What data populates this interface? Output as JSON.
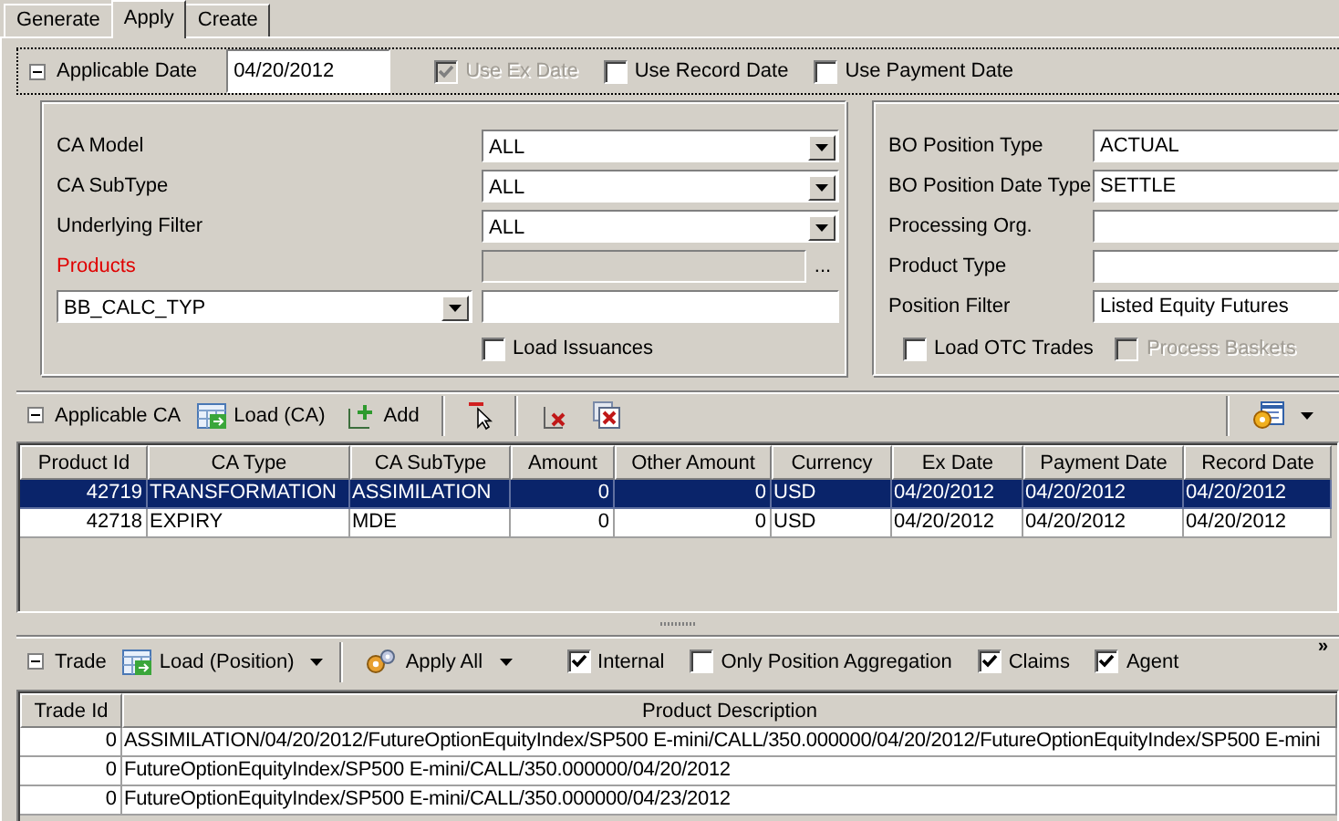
{
  "tabs": [
    {
      "label": "Generate",
      "selected": false
    },
    {
      "label": "Apply",
      "selected": true
    },
    {
      "label": "Create",
      "selected": false
    }
  ],
  "applicable_date": {
    "label": "Applicable Date",
    "expanded": true,
    "value": "04/20/2012",
    "options": [
      {
        "label": "Use Ex Date",
        "checked": true,
        "disabled": true
      },
      {
        "label": "Use Record Date",
        "checked": false,
        "disabled": false
      },
      {
        "label": "Use Payment Date",
        "checked": false,
        "disabled": false
      }
    ]
  },
  "ca_filter": {
    "rows": [
      {
        "label": "CA Model",
        "kind": "dropdown",
        "value": "ALL",
        "required": false
      },
      {
        "label": "CA SubType",
        "kind": "dropdown",
        "value": "ALL",
        "required": false
      },
      {
        "label": "Underlying Filter",
        "kind": "dropdown",
        "value": "ALL",
        "required": false
      },
      {
        "label": "Products",
        "kind": "picker",
        "button": "...",
        "required": true
      }
    ],
    "attribute": {
      "value": "BB_CALC_TYP"
    },
    "load_issuances": {
      "label": "Load Issuances",
      "checked": false
    }
  },
  "position_filter": {
    "rows": [
      {
        "label": "BO Position Type",
        "value": "ACTUAL"
      },
      {
        "label": "BO Position Date Type",
        "value": "SETTLE"
      },
      {
        "label": "Processing Org."
      },
      {
        "label": "Product Type"
      },
      {
        "label": "Position Filter",
        "value": "Listed Equity Futures"
      }
    ],
    "options": [
      {
        "label": "Load OTC Trades",
        "checked": false,
        "disabled": false
      },
      {
        "label": "Process Baskets",
        "checked": false,
        "disabled": true
      }
    ]
  },
  "applicable_ca": {
    "label": "Applicable CA",
    "expanded": true,
    "toolbar": [
      {
        "kind": "load",
        "label": "Load (CA)"
      },
      {
        "kind": "add",
        "label": "Add"
      },
      {
        "kind": "separator"
      },
      {
        "kind": "remove-pointer"
      },
      {
        "kind": "separator"
      },
      {
        "kind": "delete"
      },
      {
        "kind": "delete-all"
      }
    ],
    "table": {
      "columns": [
        {
          "label": "Product Id",
          "kind": "number"
        },
        {
          "label": "CA Type",
          "kind": "text"
        },
        {
          "label": "CA SubType",
          "kind": "text"
        },
        {
          "label": "Amount",
          "kind": "number"
        },
        {
          "label": "Other Amount",
          "kind": "number"
        },
        {
          "label": "Currency",
          "kind": "text"
        },
        {
          "label": "Ex Date",
          "kind": "text"
        },
        {
          "label": "Payment Date",
          "kind": "text"
        },
        {
          "label": "Record Date",
          "kind": "text"
        }
      ],
      "rows": [
        {
          "selected": true,
          "cells": [
            "42719",
            "TRANSFORMATION",
            "ASSIMILATION",
            "0",
            "0",
            "USD",
            "04/20/2012",
            "04/20/2012",
            "04/20/2012"
          ]
        },
        {
          "selected": false,
          "cells": [
            "42718",
            "EXPIRY",
            "MDE",
            "0",
            "0",
            "USD",
            "04/20/2012",
            "04/20/2012",
            "04/20/2012"
          ]
        }
      ]
    }
  },
  "trade": {
    "label": "Trade",
    "expanded": true,
    "overflow": "»",
    "toolbar": [
      {
        "kind": "load",
        "label": "Load (Position)",
        "menu": true
      },
      {
        "kind": "separator"
      },
      {
        "kind": "apply",
        "label": "Apply All",
        "menu": true
      }
    ],
    "options": [
      {
        "label": "Internal",
        "checked": true
      },
      {
        "label": "Only Position Aggregation",
        "checked": false
      },
      {
        "label": "Claims",
        "checked": true
      },
      {
        "label": "Agent",
        "checked": true
      }
    ],
    "table": {
      "columns": [
        {
          "label": "Trade Id",
          "kind": "number"
        },
        {
          "label": "Product Description",
          "kind": "text"
        }
      ],
      "rows": [
        {
          "selected": false,
          "cells": [
            "0",
            "ASSIMILATION/04/20/2012/FutureOptionEquityIndex/SP500 E-mini/CALL/350.000000/04/20/2012/FutureOptionEquityIndex/SP500 E-mini"
          ]
        },
        {
          "selected": false,
          "cells": [
            "0",
            "FutureOptionEquityIndex/SP500 E-mini/CALL/350.000000/04/20/2012"
          ]
        },
        {
          "selected": false,
          "cells": [
            "0",
            "FutureOptionEquityIndex/SP500 E-mini/CALL/350.000000/04/23/2012"
          ]
        }
      ]
    }
  }
}
